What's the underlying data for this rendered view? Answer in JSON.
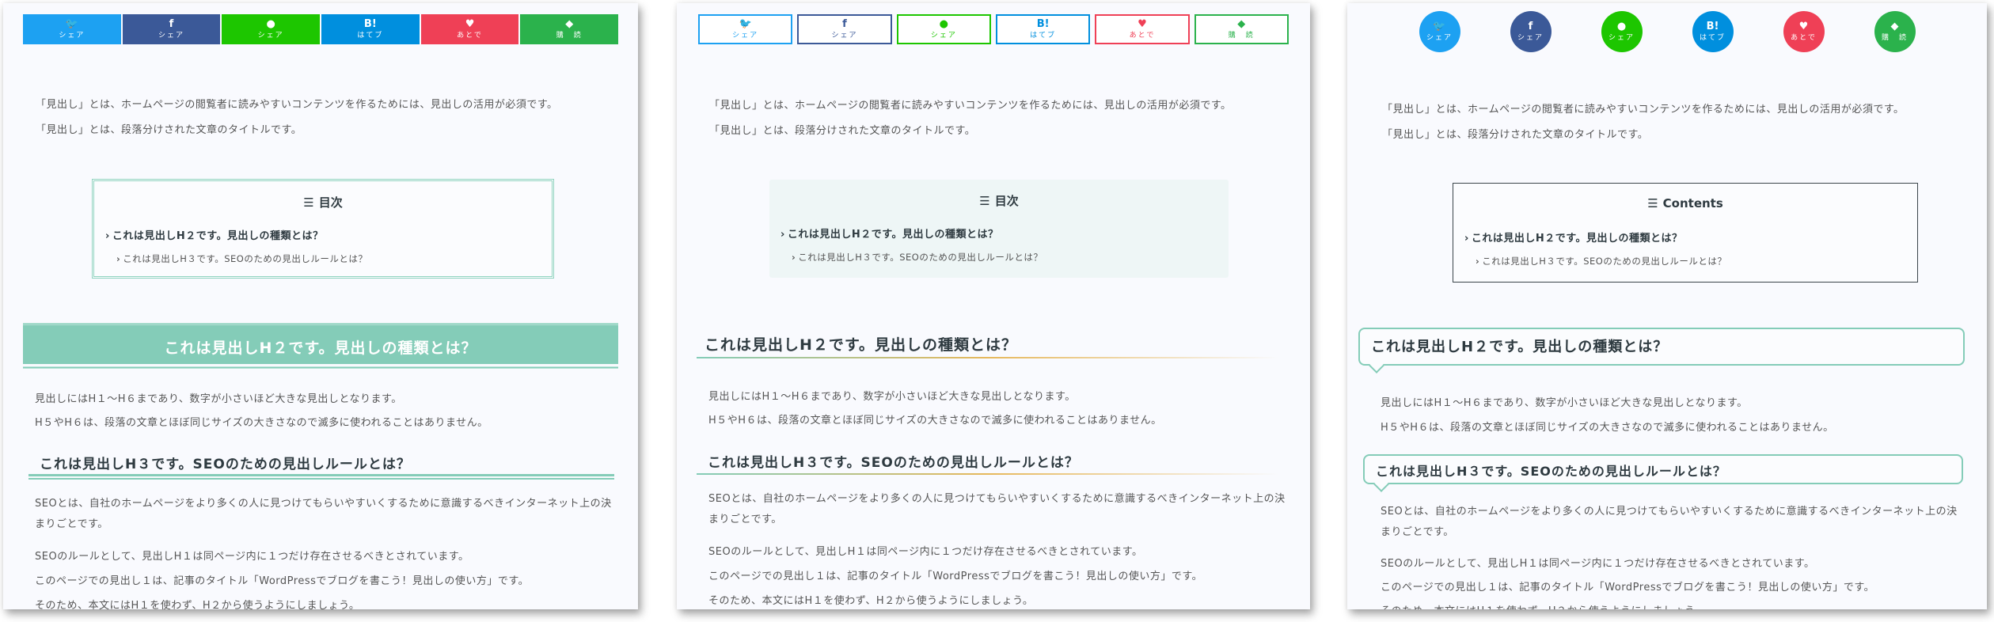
{
  "share_buttons": [
    {
      "service": "twitter",
      "icon": "twitter-bird-icon",
      "glyph": "🐦",
      "label": "シェア",
      "color": "#1da1f2"
    },
    {
      "service": "facebook",
      "icon": "facebook-f-icon",
      "glyph": "f",
      "label": "シェア",
      "color": "#3b5998"
    },
    {
      "service": "line",
      "icon": "line-icon",
      "glyph": "●",
      "label": "シェア",
      "color": "#1dc600"
    },
    {
      "service": "hatena",
      "icon": "hatena-bookmark-icon",
      "glyph": "B!",
      "label": "はてブ",
      "color": "#008fde"
    },
    {
      "service": "pocket",
      "icon": "pocket-icon",
      "glyph": "♥",
      "label": "あとで",
      "color": "#ef4056"
    },
    {
      "service": "feedly",
      "icon": "feedly-icon",
      "glyph": "◆",
      "label": "購　読",
      "color": "#2bb24c"
    }
  ],
  "intro": [
    "「見出し」とは、ホームページの閲覧者に読みやすいコンテンツを作るためには、見出しの活用が必須です。",
    "「見出し」とは、段落分けされた文章のタイトルです。"
  ],
  "toc": {
    "title_ja": "目次",
    "title_en": "Contents",
    "item_h2": "これは見出しH２です。見出しの種類とは？",
    "item_h3": "これは見出しH３です。SEOのための見出しルールとは？"
  },
  "h2": "これは見出しH２です。見出しの種類とは？",
  "h2_body": [
    "見出しにはH１～H６まであり、数字が小さいほど大きな見出しとなります。",
    "H５やH６は、段落の文章とほぼ同じサイズの大きさなので滅多に使われることはありません。"
  ],
  "h3": "これは見出しH３です。SEOのための見出しルールとは？",
  "h3_body": [
    "SEOとは、自社のホームページをより多くの人に見つけてもらいやすいくするために意識するべきインターネット上の決まりごとです。",
    "SEOのルールとして、見出しH１は同ページ内に１つだけ存在させるべきとされています。",
    "このページでの見出し１は、記事のタイトル「WordPressでブログを書こう！見出しの使い方」です。",
    "そのため、本文にはH１を使わず、H２から使うようにしましょう。"
  ],
  "colors": {
    "accent": "#84ccb8",
    "gradient_mid": "#e6b85c",
    "text_dark": "#2e3a40"
  }
}
